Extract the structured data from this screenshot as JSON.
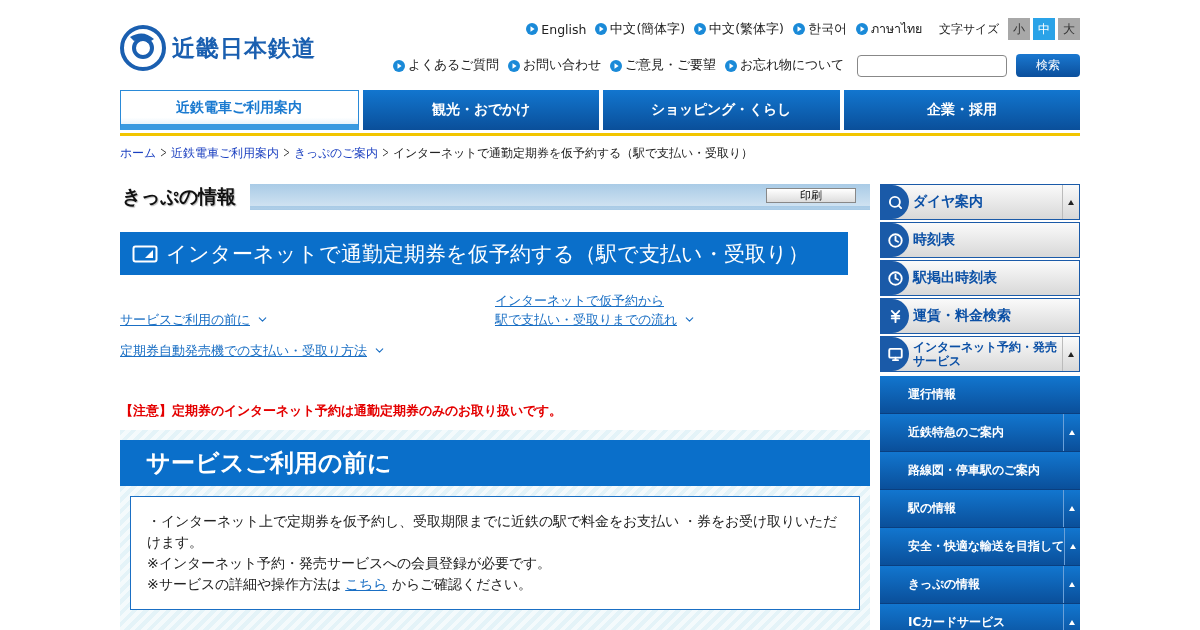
{
  "logo": {
    "text": "近畿日本鉄道"
  },
  "languages": [
    "English",
    "中文(簡体字)",
    "中文(繁体字)",
    "한국어",
    "ภาษาไทย"
  ],
  "font_size": {
    "label": "文字サイズ",
    "options": [
      {
        "label": "小",
        "selected": false
      },
      {
        "label": "中",
        "selected": true
      },
      {
        "label": "大",
        "selected": false
      }
    ]
  },
  "utility_links": [
    "よくあるご質問",
    "お問い合わせ",
    "ご意見・ご要望",
    "お忘れ物について"
  ],
  "search": {
    "button": "検索"
  },
  "nav_tabs": [
    {
      "label": "近鉄電車ご利用案内",
      "selected": true
    },
    {
      "label": "観光・おでかけ",
      "selected": false
    },
    {
      "label": "ショッピング・くらし",
      "selected": false
    },
    {
      "label": "企業・採用",
      "selected": false
    }
  ],
  "breadcrumb": [
    {
      "label": "ホーム",
      "kind": "link"
    },
    {
      "label": "近鉄電車ご利用案内",
      "kind": "link"
    },
    {
      "label": "きっぷのご案内",
      "kind": "link"
    },
    {
      "label": "インターネットで通勤定期券を仮予約する（駅で支払い・受取り）",
      "kind": "current"
    }
  ],
  "section_title": "きっぷの情報",
  "print_button": "印刷",
  "page_heading": "インターネットで通勤定期券を仮予約する（駅で支払い・受取り）",
  "anchor_links": [
    {
      "lines": [
        "サービスご利用の前に"
      ]
    },
    {
      "lines": [
        "インターネットで仮予約から",
        "駅で支払い・受取りまでの流れ"
      ]
    },
    {
      "lines": [
        "定期券自動発売機での支払い・受取り方法"
      ]
    }
  ],
  "notice": "【注意】定期券のインターネット予約は通勤定期券のみのお取り扱いです。",
  "section": {
    "heading": "サービスご利用の前に",
    "paragraphs": [
      {
        "text": "・インターネット上で定期券を仮予約し、受取期限までに近鉄の駅で料金をお支払い ・券をお受け取りいただけます。"
      },
      {
        "text": "※インターネット予約・発売サービスへの会員登録が必要です。"
      },
      {
        "text": "※サービスの詳細や操作方法は ",
        "link": "こちら",
        "after": " からご確認ください。"
      }
    ]
  },
  "sidebar": {
    "top_menu": [
      {
        "label": "ダイヤ案内",
        "kind": "search",
        "expandable": true
      },
      {
        "label": "時刻表",
        "kind": "clock",
        "expandable": false
      },
      {
        "label": "駅掲出時刻表",
        "kind": "clock",
        "expandable": false
      },
      {
        "label": "運賃・料金検索",
        "kind": "yen",
        "expandable": false
      },
      {
        "label": "インターネット予約・発売サービス",
        "kind": "monitor",
        "expandable": true
      }
    ],
    "sub_menu": [
      {
        "label": "運行情報",
        "expandable": false
      },
      {
        "label": "近鉄特急のご案内",
        "expandable": true
      },
      {
        "label": "路線図・停車駅のご案内",
        "expandable": false
      },
      {
        "label": "駅の情報",
        "expandable": true
      },
      {
        "label": "安全・快適な輸送を目指して",
        "expandable": true
      },
      {
        "label": "きっぷの情報",
        "expandable": true
      },
      {
        "label": "ICカードサービス",
        "expandable": true
      }
    ]
  }
}
